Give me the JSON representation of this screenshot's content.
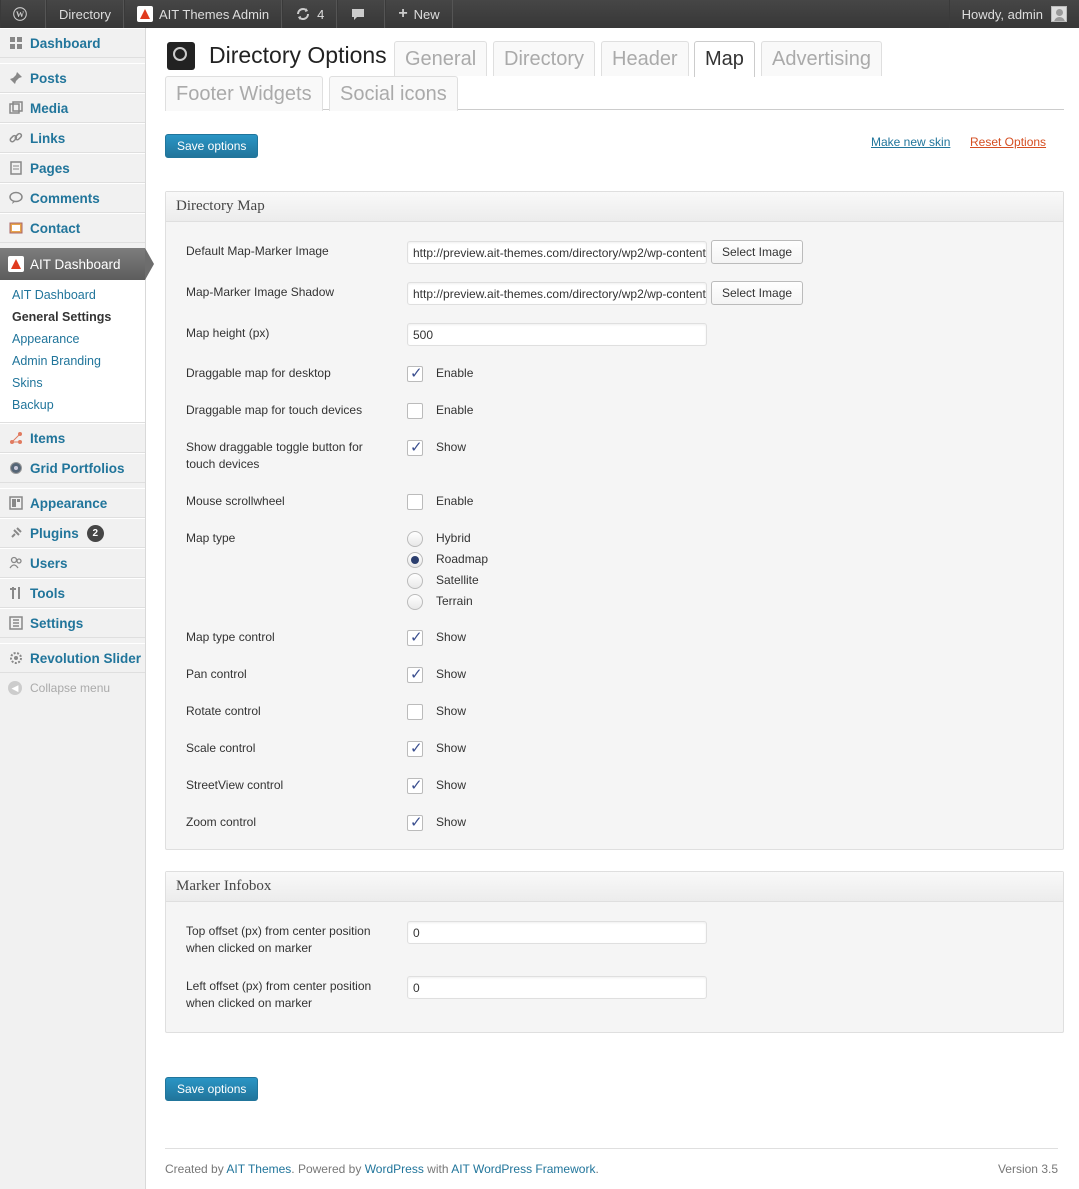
{
  "adminbar": {
    "site": "Directory",
    "theme_admin": "AIT Themes Admin",
    "updates": "4",
    "new": "New",
    "howdy": "Howdy, admin"
  },
  "sidebar": {
    "dashboard": "Dashboard",
    "posts": "Posts",
    "media": "Media",
    "links": "Links",
    "pages": "Pages",
    "comments": "Comments",
    "contact": "Contact",
    "ait_dashboard": "AIT Dashboard",
    "submenu": [
      "AIT Dashboard",
      "General Settings",
      "Appearance",
      "Admin Branding",
      "Skins",
      "Backup"
    ],
    "items": "Items",
    "grid_portfolios": "Grid Portfolios",
    "appearance": "Appearance",
    "plugins": "Plugins",
    "plugins_badge": "2",
    "users": "Users",
    "tools": "Tools",
    "settings": "Settings",
    "revolution_slider": "Revolution Slider",
    "collapse": "Collapse menu"
  },
  "header": {
    "title": "Directory Options",
    "tabs": [
      "General",
      "Directory",
      "Header",
      "Map",
      "Advertising",
      "Footer Widgets",
      "Social icons"
    ],
    "active_tab": "Map"
  },
  "actions": {
    "save": "Save options",
    "make_skin": "Make new skin",
    "reset": "Reset Options"
  },
  "map_panel": {
    "title": "Directory Map",
    "marker_image_label": "Default Map-Marker Image",
    "marker_image_value": "http://preview.ait-themes.com/directory/wp2/wp-content",
    "shadow_label": "Map-Marker Image Shadow",
    "shadow_value": "http://preview.ait-themes.com/directory/wp2/wp-content",
    "select_image": "Select Image",
    "height_label": "Map height (px)",
    "height_value": "500",
    "draggable_desktop": "Draggable map for desktop",
    "draggable_touch": "Draggable map for touch devices",
    "toggle_button": "Show draggable toggle button for touch devices",
    "scrollwheel": "Mouse scrollwheel",
    "map_type": "Map type",
    "map_types": [
      "Hybrid",
      "Roadmap",
      "Satellite",
      "Terrain"
    ],
    "selected_map_type": "Roadmap",
    "map_type_control": "Map type control",
    "pan_control": "Pan control",
    "rotate_control": "Rotate control",
    "scale_control": "Scale control",
    "streetview_control": "StreetView control",
    "zoom_control": "Zoom control",
    "enable": "Enable",
    "show": "Show"
  },
  "infobox_panel": {
    "title": "Marker Infobox",
    "top_label": "Top offset (px) from center position when clicked on marker",
    "top_value": "0",
    "left_label": "Left offset (px) from center position when clicked on marker",
    "left_value": "0"
  },
  "footer": {
    "created_by": "Created by",
    "ait": "AIT Themes",
    "powered": ". Powered by",
    "wordpress": "WordPress",
    "with": "with",
    "framework": "AIT WordPress Framework",
    "dot": ".",
    "version": "Version 3.5"
  },
  "colors": {
    "link": "#21759b",
    "reset_link": "#d54e21",
    "primary": "#21759b"
  }
}
